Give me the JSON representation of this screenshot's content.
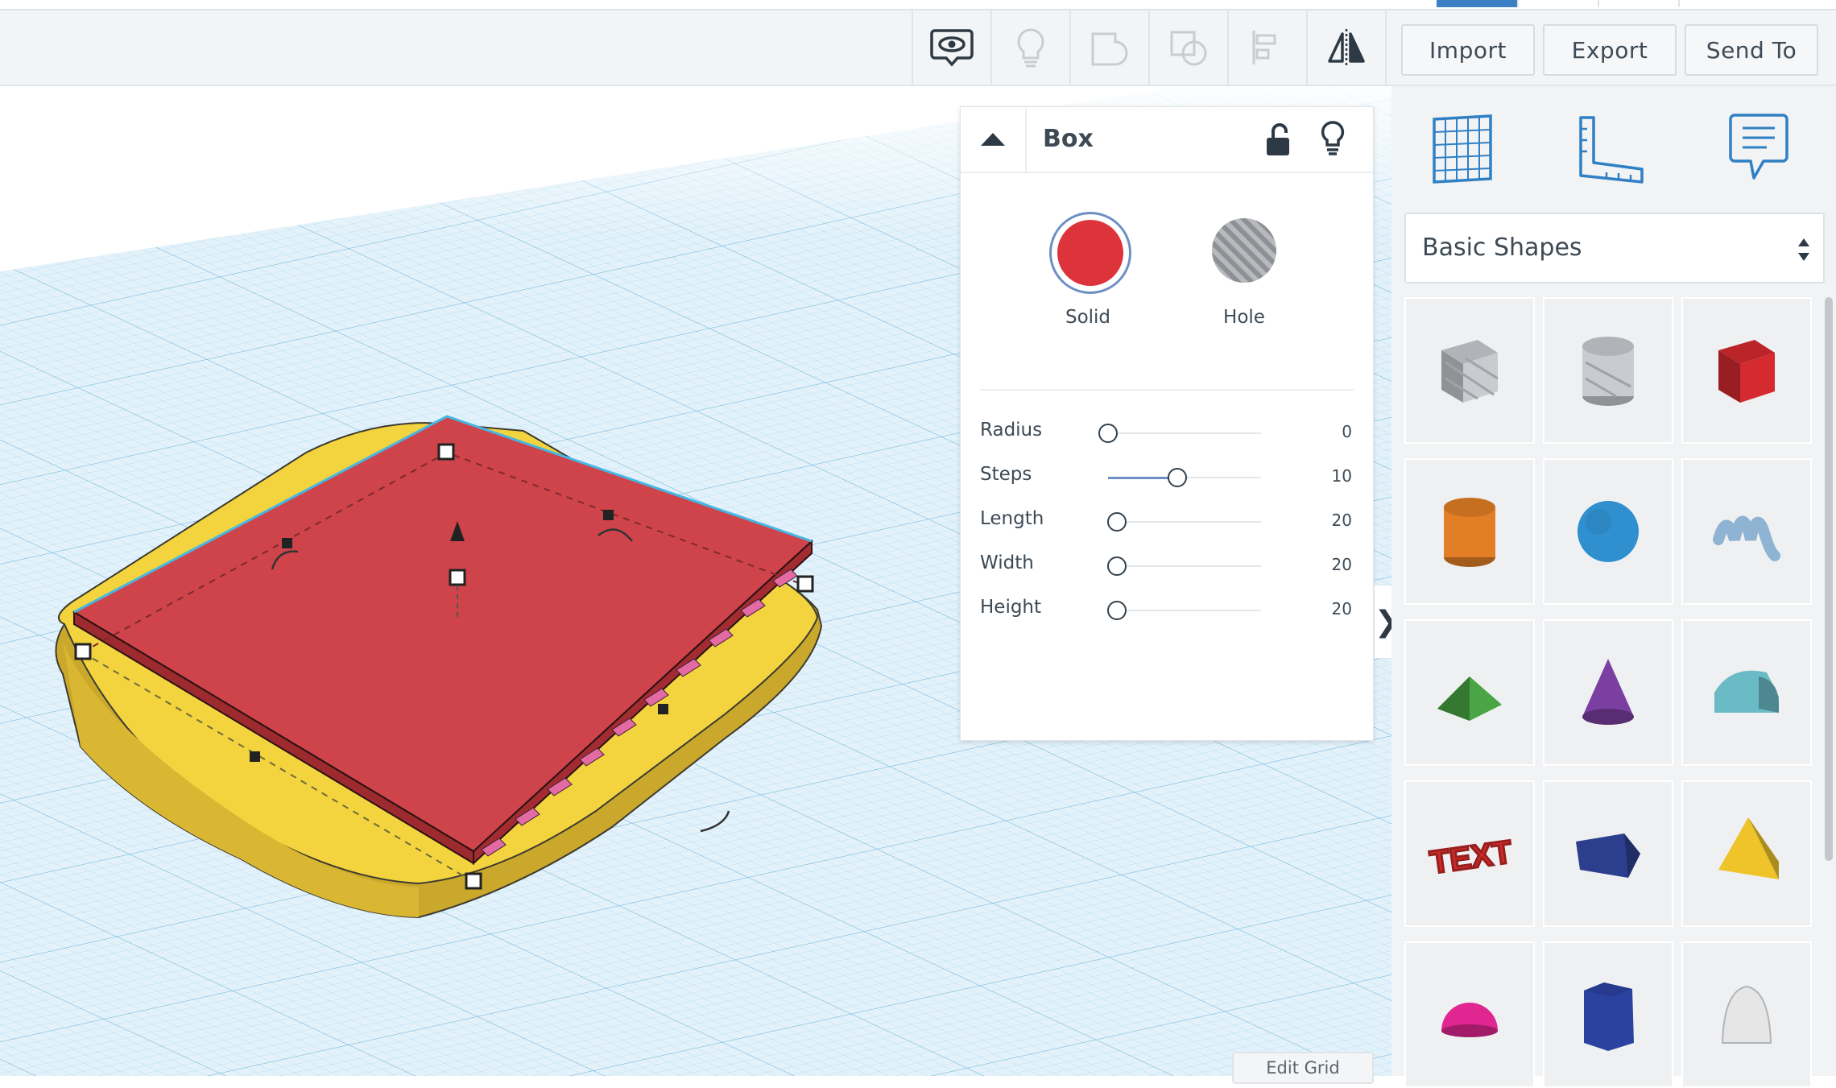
{
  "toolbar": {
    "tools": [
      {
        "name": "notes",
        "icon": "speech-bubble-eye-icon"
      },
      {
        "name": "show-all",
        "icon": "lightbulb-icon"
      },
      {
        "name": "group",
        "icon": "group-shapes-icon"
      },
      {
        "name": "ungroup",
        "icon": "ungroup-shapes-icon"
      },
      {
        "name": "align",
        "icon": "align-icon"
      },
      {
        "name": "mirror",
        "icon": "mirror-icon"
      }
    ],
    "import_label": "Import",
    "export_label": "Export",
    "send_to_label": "Send To"
  },
  "inspector": {
    "title": "Box",
    "solid_label": "Solid",
    "hole_label": "Hole",
    "solid_color": "#dd343b",
    "params": [
      {
        "label": "Radius",
        "value": "0",
        "level": 0.0
      },
      {
        "label": "Steps",
        "value": "10",
        "level": 0.45
      },
      {
        "label": "Length",
        "value": "20",
        "level": 0.06
      },
      {
        "label": "Width",
        "value": "20",
        "level": 0.06
      },
      {
        "label": "Height",
        "value": "20",
        "level": 0.06
      }
    ]
  },
  "workplane": {
    "edit_grid_label": "Edit Grid"
  },
  "right_panel": {
    "icons": [
      "grid-icon",
      "ruler-icon",
      "notes-icon"
    ],
    "shapes_category": "Basic Shapes",
    "shapes": [
      {
        "name": "box-hole",
        "color": "#c8ccd1"
      },
      {
        "name": "cylinder-hole",
        "color": "#c8ccd1"
      },
      {
        "name": "box",
        "color": "#d42a30"
      },
      {
        "name": "cylinder",
        "color": "#e27e25"
      },
      {
        "name": "sphere",
        "color": "#2f8fcf"
      },
      {
        "name": "scribble",
        "color": "#8fb3d3"
      },
      {
        "name": "roof",
        "color": "#4aa644"
      },
      {
        "name": "cone",
        "color": "#7b3fa1"
      },
      {
        "name": "round-roof",
        "color": "#6bbbc7"
      },
      {
        "name": "text",
        "color": "#d02a2a"
      },
      {
        "name": "wedge",
        "color": "#2c3f8f"
      },
      {
        "name": "pyramid",
        "color": "#eec42a"
      },
      {
        "name": "half-sphere",
        "color": "#e02690"
      },
      {
        "name": "polygon",
        "color": "#2b43a0"
      },
      {
        "name": "paraboloid",
        "color": "#e6e6e6"
      }
    ]
  }
}
